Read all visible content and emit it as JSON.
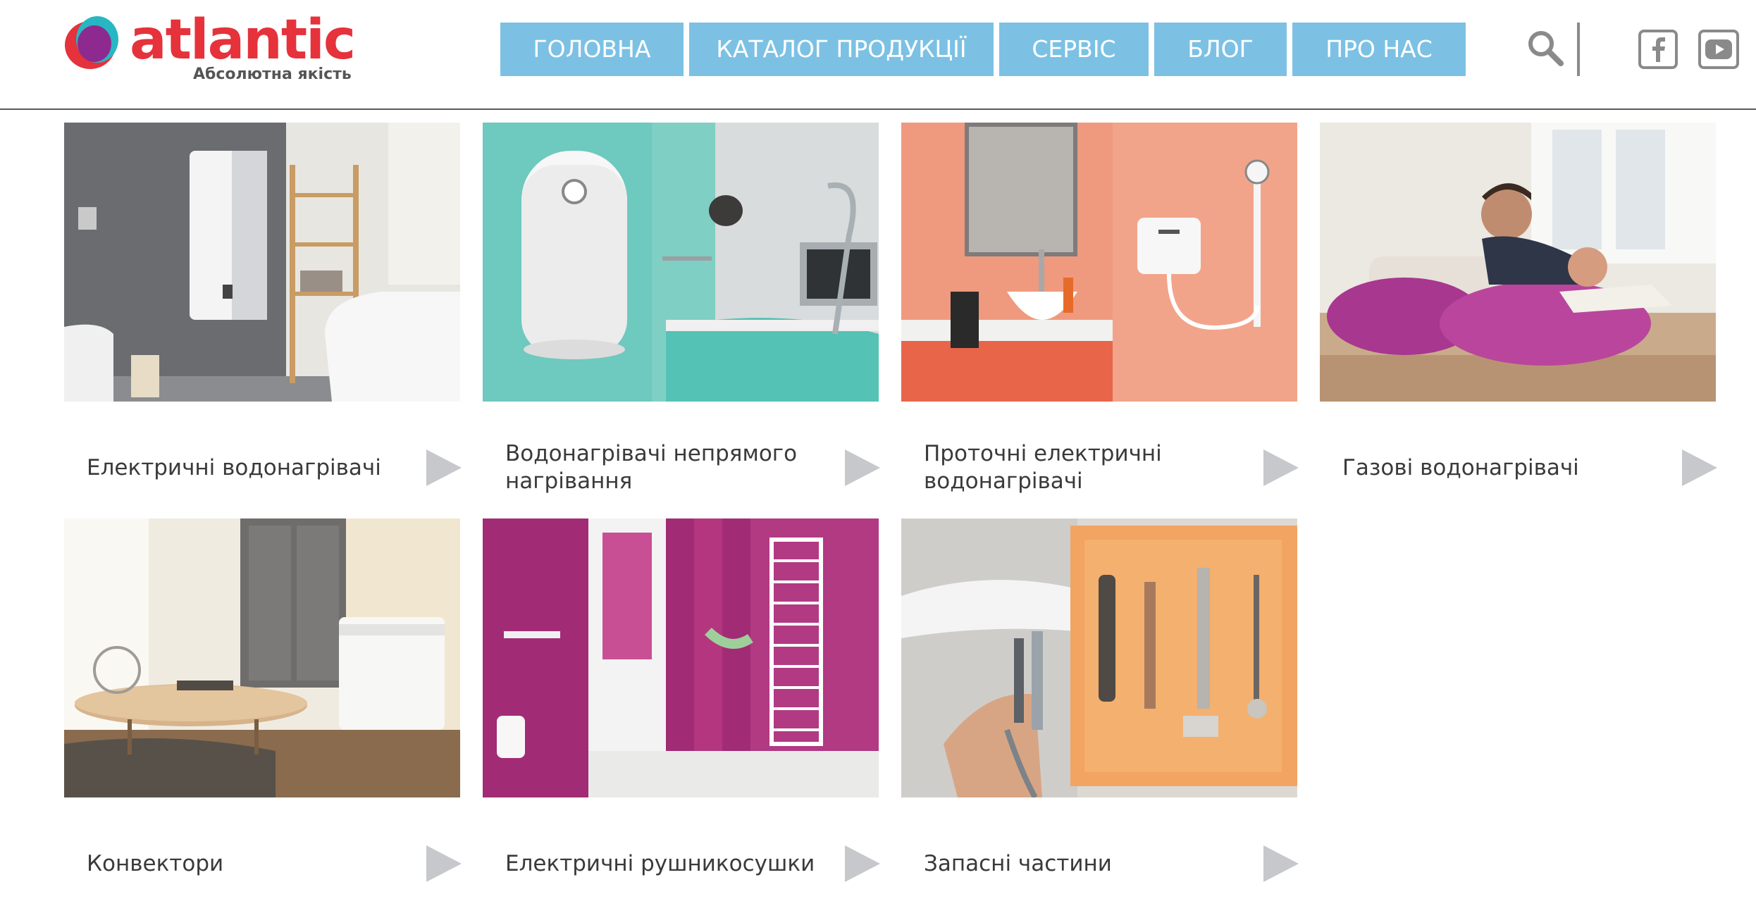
{
  "brand": {
    "name": "atlantic",
    "tagline": "Абсолютна якість",
    "colors": {
      "red": "#e5323b",
      "purple": "#8e2a8f",
      "teal": "#27b7c3",
      "nav": "#7cc1e4",
      "arrow": "#c7c8cc"
    }
  },
  "nav": {
    "items": [
      {
        "label": "ГОЛОВНА"
      },
      {
        "label": "КАТАЛОГ ПРОДУКЦІЇ"
      },
      {
        "label": "СЕРВІС"
      },
      {
        "label": "БЛОГ"
      },
      {
        "label": "ПРО НАС"
      }
    ]
  },
  "header_icons": {
    "search": "search-icon",
    "facebook": "facebook-icon",
    "youtube": "youtube-icon"
  },
  "categories": [
    {
      "label": "Електричні водонагрівачі",
      "image": "bathroom-water-heater-photo"
    },
    {
      "label": "Водонагрівачі непрямого нагрівання",
      "image": "kitchen-water-heater-photo"
    },
    {
      "label": "Проточні електричні водонагрівачі",
      "image": "instant-heater-shower-photo"
    },
    {
      "label": "Газові водонагрівачі",
      "image": "father-and-child-pillows-photo"
    },
    {
      "label": "Конвектори",
      "image": "living-room-convector-photo"
    },
    {
      "label": "Електричні рушникосушки",
      "image": "towel-rail-bathroom-photo"
    },
    {
      "label": "Запасні частини",
      "image": "spare-parts-photo"
    }
  ]
}
